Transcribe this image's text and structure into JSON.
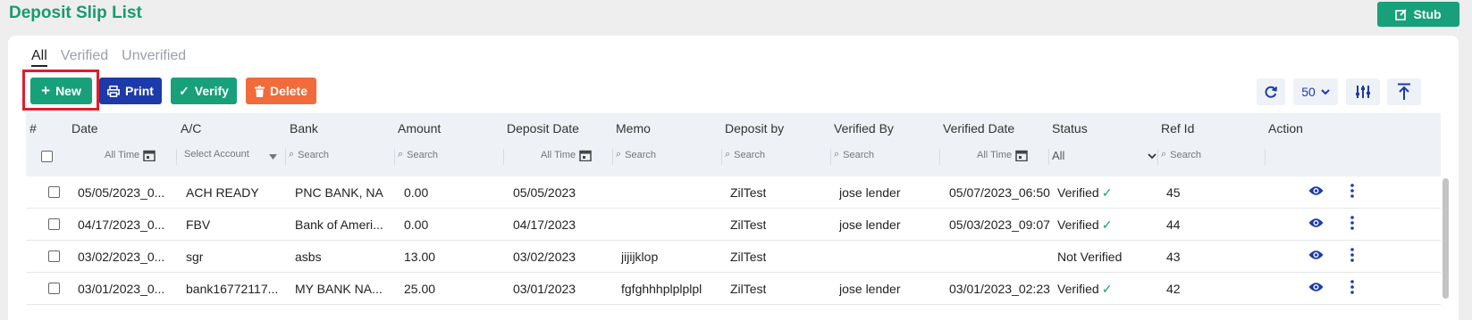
{
  "page": {
    "title": "Deposit Slip List",
    "stub_label": "Stub"
  },
  "tabs": [
    {
      "label": "All",
      "active": true
    },
    {
      "label": "Verified",
      "active": false
    },
    {
      "label": "Unverified",
      "active": false
    }
  ],
  "toolbar": {
    "new_label": "New",
    "print_label": "Print",
    "verify_label": "Verify",
    "delete_label": "Delete",
    "page_size": "50"
  },
  "columns": [
    "#",
    "Date",
    "A/C",
    "Bank",
    "Amount",
    "Deposit Date",
    "Memo",
    "Deposit by",
    "Verified By",
    "Verified Date",
    "Status",
    "Ref Id",
    "Action"
  ],
  "filters": {
    "date": "All Time",
    "account_placeholder": "Select Account",
    "search_placeholder": "Search",
    "verified_date": "All Time",
    "status": "All"
  },
  "rows": [
    {
      "date": "05/05/2023_0...",
      "ac": "ACH READY",
      "bank": "PNC BANK, NA",
      "amount": "0.00",
      "deposit_date": "05/05/2023",
      "memo": "",
      "deposit_by": "ZilTest",
      "verified_by": "jose lender",
      "verified_date": "05/07/2023_06:50",
      "status": "Verified",
      "ref_id": "45"
    },
    {
      "date": "04/17/2023_0...",
      "ac": "FBV",
      "bank": "Bank of Ameri...",
      "amount": "0.00",
      "deposit_date": "04/17/2023",
      "memo": "",
      "deposit_by": "ZilTest",
      "verified_by": "jose lender",
      "verified_date": "05/03/2023_09:07",
      "status": "Verified",
      "ref_id": "44"
    },
    {
      "date": "03/02/2023_0...",
      "ac": "sgr",
      "bank": "asbs",
      "amount": "13.00",
      "deposit_date": "03/02/2023",
      "memo": "jijijklop",
      "deposit_by": "ZilTest",
      "verified_by": "",
      "verified_date": "",
      "status": "Not Verified",
      "ref_id": "43"
    },
    {
      "date": "03/01/2023_0...",
      "ac": "bank16772117...",
      "bank": "MY BANK NA...",
      "amount": "25.00",
      "deposit_date": "03/01/2023",
      "memo": "fgfghhhplplplpl",
      "deposit_by": "ZilTest",
      "verified_by": "jose lender",
      "verified_date": "03/01/2023_02:23",
      "status": "Verified",
      "ref_id": "42"
    }
  ],
  "colors": {
    "brand": "#17a079",
    "primary": "#1c3aa9",
    "danger": "#f26b3a",
    "highlight": "#e11d2a"
  }
}
